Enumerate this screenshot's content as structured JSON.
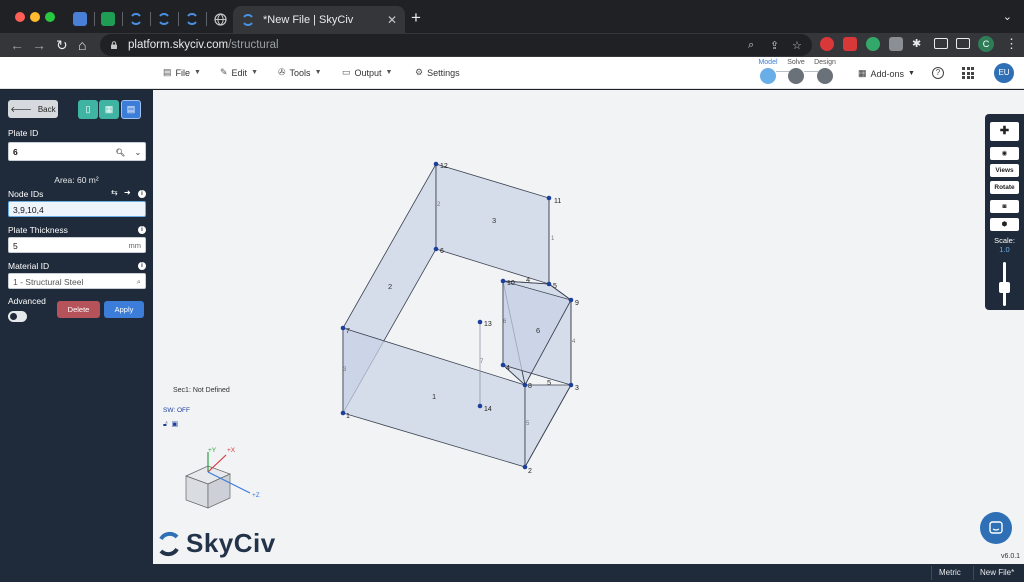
{
  "browser": {
    "active_tab_title": "*New File | SkyCiv",
    "url_host": "platform.skyciv.com",
    "url_path": "/structural",
    "profile_initial": "C",
    "pinned_tabs": [
      {
        "icon": "docs-icon",
        "color": "#4a7fd8"
      },
      {
        "icon": "sheets-icon",
        "color": "#1f9d55"
      },
      {
        "icon": "skyciv-icon",
        "color": "#4a90e2"
      },
      {
        "icon": "skyciv-icon",
        "color": "#4a90e2"
      },
      {
        "icon": "skyciv-icon",
        "color": "#4a90e2"
      },
      {
        "icon": "globe-icon",
        "color": "#9aa0a6"
      }
    ]
  },
  "menu": {
    "file": "File",
    "edit": "Edit",
    "tools": "Tools",
    "output": "Output",
    "settings": "Settings"
  },
  "stages": {
    "model": "Model",
    "solve": "Solve",
    "design": "Design"
  },
  "header": {
    "addons": "Add-ons",
    "help": "?",
    "user_initials": "EU"
  },
  "panel": {
    "back": "Back",
    "plate_id_label": "Plate ID",
    "plate_id_value": "6",
    "area_text": "Area: 60 m²",
    "node_ids_label": "Node IDs",
    "node_ids_value": "3,9,10,4",
    "thickness_label": "Plate Thickness",
    "thickness_value": "5",
    "thickness_unit": "mm",
    "material_label": "Material ID",
    "material_value": "1 - Structural Steel",
    "advanced_label": "Advanced",
    "advanced_on": false,
    "delete": "Delete",
    "apply": "Apply"
  },
  "canvas": {
    "section_text": "Sec1: Not Defined",
    "sw_text": "SW: OFF",
    "axes": {
      "y": "+Y",
      "x": "+X",
      "z": "+Z"
    },
    "logo_text": "SkyCiv",
    "version": "v6.0.1",
    "node_labels": [
      "1",
      "2",
      "3",
      "4",
      "5",
      "6",
      "7",
      "8",
      "9",
      "10",
      "11",
      "12",
      "13",
      "14"
    ],
    "plate_labels": [
      "1",
      "2",
      "3",
      "4",
      "5",
      "6"
    ],
    "member_labels": [
      "1",
      "2",
      "3",
      "4",
      "5",
      "6",
      "7"
    ]
  },
  "right_toolbar": {
    "views": "Views",
    "rotate": "Rotate",
    "scale_label": "Scale:",
    "scale_value": "1.0"
  },
  "status": {
    "units": "Metric",
    "file": "New File*"
  },
  "colors": {
    "accent": "#3b7dd8",
    "panel_bg": "#1f2b3a",
    "plate_fill": "#c9d3e6",
    "node": "#1d3f9c",
    "delete": "#b5525a"
  }
}
